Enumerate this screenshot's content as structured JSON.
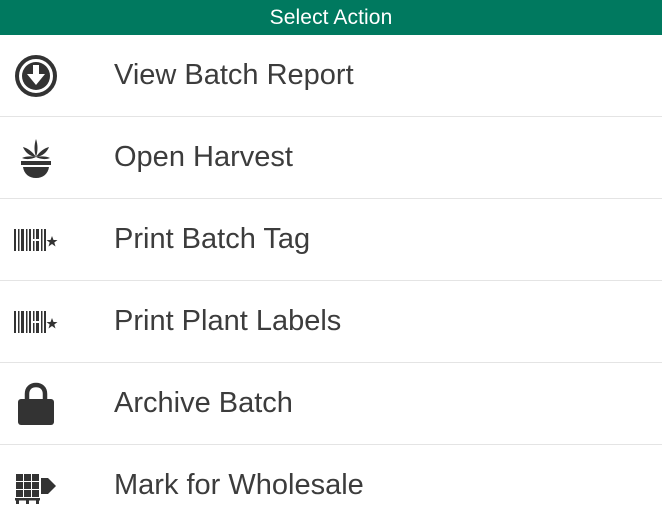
{
  "header": {
    "title": "Select Action"
  },
  "colors": {
    "header_bg": "#00795f",
    "header_text": "#ffffff",
    "icon": "#333333",
    "label_text": "#3c3c3c",
    "divider": "#e4e4e4"
  },
  "actions": [
    {
      "label": "View Batch Report",
      "icon": "download-circle-icon"
    },
    {
      "label": "Open Harvest",
      "icon": "cannabis-pot-icon"
    },
    {
      "label": "Print Batch Tag",
      "icon": "barcode-icon"
    },
    {
      "label": "Print Plant Labels",
      "icon": "barcode-icon"
    },
    {
      "label": "Archive Batch",
      "icon": "lock-icon"
    },
    {
      "label": "Mark for Wholesale",
      "icon": "pallet-arrow-icon"
    }
  ]
}
